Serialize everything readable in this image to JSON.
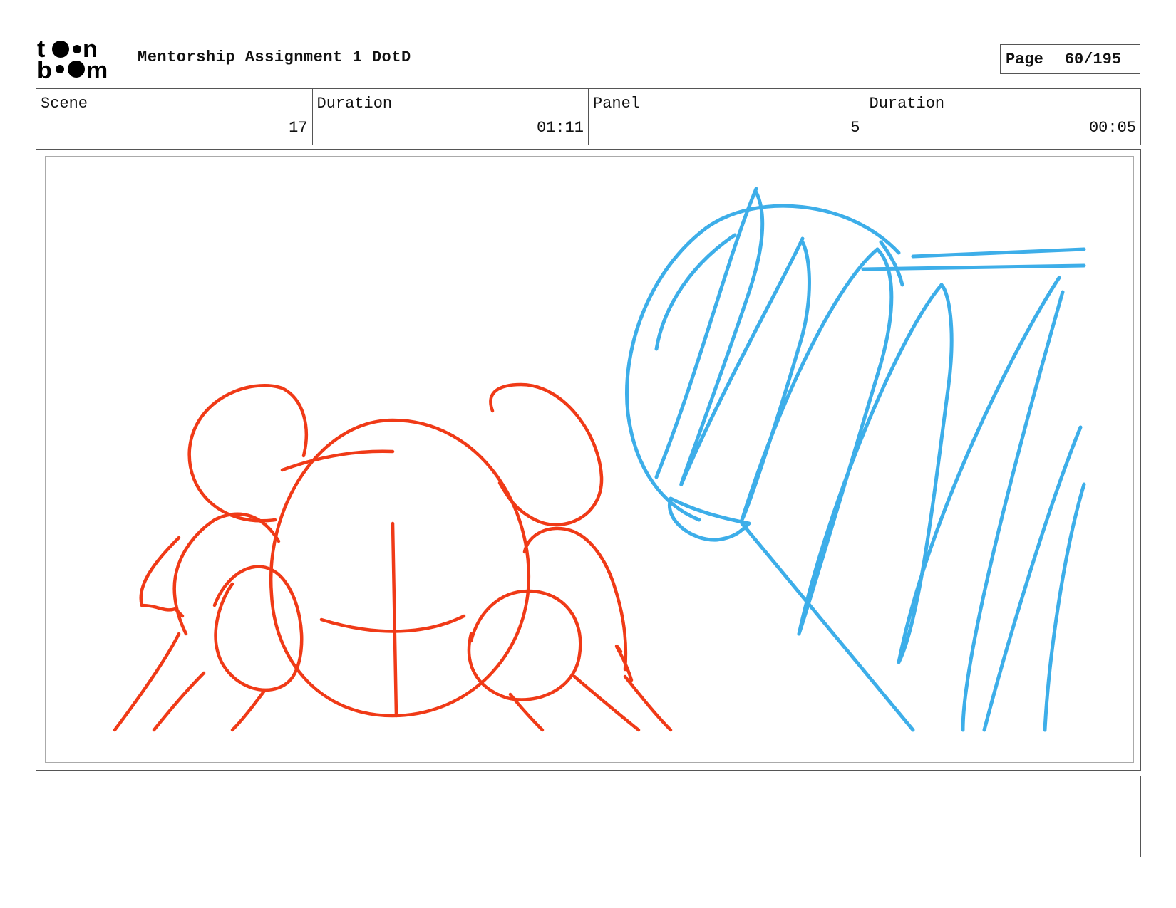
{
  "header": {
    "logo_text": "toon boom",
    "title": "Mentorship Assignment 1 DotD",
    "page_label": "Page",
    "page_value": "60/195"
  },
  "info": {
    "scene_label": "Scene",
    "scene_value": "17",
    "scene_duration_label": "Duration",
    "scene_duration_value": "01:11",
    "panel_label": "Panel",
    "panel_value": "5",
    "panel_duration_label": "Duration",
    "panel_duration_value": "00:05"
  },
  "sketch": {
    "foreground_color": "#f03a17",
    "background_color": "#3daee9"
  },
  "notes": {
    "text": ""
  }
}
